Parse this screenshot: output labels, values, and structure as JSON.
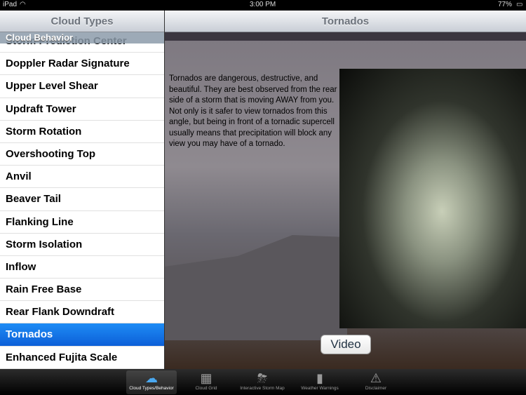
{
  "status": {
    "device": "iPad",
    "time": "3:00 PM",
    "battery": "77%"
  },
  "master": {
    "title": "Cloud Types",
    "section": "Cloud Behavior",
    "items": [
      "Storm Prediction Center",
      "Doppler Radar Signature",
      "Upper Level Shear",
      "Updraft Tower",
      "Storm Rotation",
      "Overshooting Top",
      "Anvil",
      "Beaver Tail",
      "Flanking Line",
      "Storm Isolation",
      "Inflow",
      "Rain Free Base",
      "Rear Flank Downdraft",
      "Tornados",
      "Enhanced Fujita Scale"
    ],
    "selected": "Tornados"
  },
  "detail": {
    "title": "Tornados",
    "description": "Tornados are dangerous, destructive, and beautiful. They are best observed from the rear side of a storm that is moving AWAY from you.  Not only is it safer to view tornados from this angle, but being in front of a tornadic supercell usually means that precipitation will block any view you may have of a tornado.",
    "video_label": "Video"
  },
  "tabs": [
    {
      "label": "Cloud Types/Behavior",
      "icon": "cloud-icon"
    },
    {
      "label": "Cloud Grid",
      "icon": "grid-icon"
    },
    {
      "label": "Interactive Storm Map",
      "icon": "storm-icon"
    },
    {
      "label": "Weather Warnings",
      "icon": "warning-sign-icon"
    },
    {
      "label": "Disclaimer",
      "icon": "alert-triangle-icon"
    }
  ],
  "colors": {
    "selection": "#1679ec"
  }
}
